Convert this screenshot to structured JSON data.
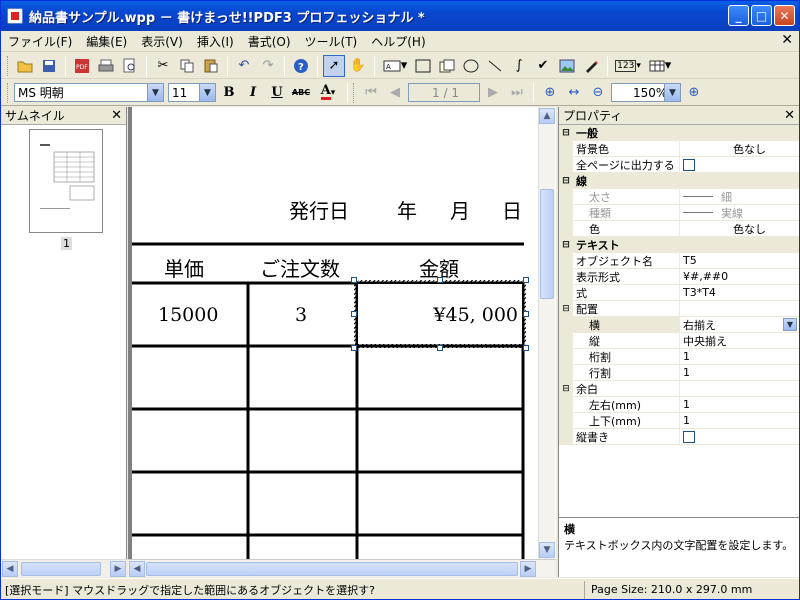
{
  "window": {
    "title": "納品書サンプル.wpp － 書けまっせ!!PDF3 プロフェッショナル *"
  },
  "menu": [
    "ファイル(F)",
    "編集(E)",
    "表示(V)",
    "挿入(I)",
    "書式(O)",
    "ツール(T)",
    "ヘルプ(H)"
  ],
  "toolbar": {
    "font_name": "MS 明朝",
    "font_size": "11",
    "bold_label": "B",
    "italic_label": "I",
    "underline_label": "U",
    "strike_label": "ABC",
    "color_label": "A",
    "page_indicator": "1 / 1",
    "zoom": "150%",
    "line_spacing_label": "123"
  },
  "thumbnail_pane": {
    "title": "サムネイル",
    "page_number": "1"
  },
  "document": {
    "issue_date_label": "発行日",
    "year_label": "年",
    "month_label": "月",
    "day_label": "日",
    "headers": [
      "単価",
      "ご注文数",
      "金額"
    ],
    "row1": {
      "price": "15000",
      "qty": "3",
      "amount": "¥45, 000"
    }
  },
  "properties": {
    "title": "プロパティ",
    "general": {
      "label": "一般",
      "bg_color_key": "背景色",
      "bg_color_val": "色なし",
      "all_pages_key": "全ページに出力する"
    },
    "line": {
      "label": "線",
      "width_key": "太さ",
      "width_val": "細",
      "type_key": "種類",
      "type_val": "実線",
      "color_key": "色",
      "color_val": "色なし"
    },
    "text": {
      "label": "テキスト",
      "obj_name_key": "オブジェクト名",
      "obj_name_val": "T5",
      "format_key": "表示形式",
      "format_val": "¥#,##0",
      "formula_key": "式",
      "formula_val": "T3*T4",
      "align_key": "配置",
      "h_key": "横",
      "h_val": "右揃え",
      "v_key": "縦",
      "v_val": "中央揃え",
      "col_split_key": "桁割",
      "col_split_val": "1",
      "row_split_key": "行割",
      "row_split_val": "1"
    },
    "margin": {
      "label": "余白",
      "lr_key": "左右(mm)",
      "lr_val": "1",
      "tb_key": "上下(mm)",
      "tb_val": "1"
    },
    "vertical_key": "縦書き",
    "description_title": "横",
    "description_text": "テキストボックス内の文字配置を設定します。"
  },
  "status": {
    "mode": "[選択モード] マウスドラッグで指定した範囲にあるオブジェクトを選択す?",
    "page_size": "Page Size: 210.0 x 297.0 mm"
  },
  "colors": {
    "titlebar": "#0a5fe4",
    "selection": "#1c5180"
  }
}
